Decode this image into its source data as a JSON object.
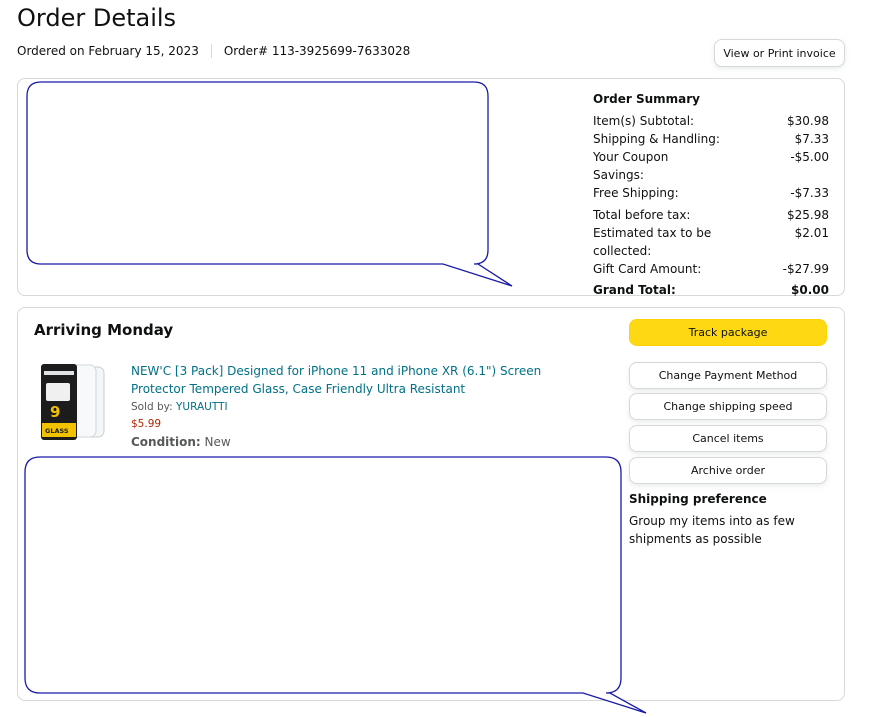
{
  "header": {
    "title": "Order Details",
    "ordered_on": "Ordered on February 15, 2023",
    "order_number": "Order# 113-3925699-7633028",
    "invoice_button": "View or Print invoice"
  },
  "summary": {
    "heading": "Order Summary",
    "subtotal": {
      "label": "Item(s) Subtotal:",
      "value": "$30.98"
    },
    "shipping": {
      "label": "Shipping & Handling:",
      "value": "$7.33"
    },
    "coupon": {
      "label": "Your Coupon Savings:",
      "value": "-$5.00"
    },
    "free_shipping": {
      "label": "Free Shipping:",
      "value": "-$7.33"
    },
    "before_tax": {
      "label": "Total before tax:",
      "value": "$25.98"
    },
    "tax": {
      "label": "Estimated tax to be collected:",
      "value": "$2.01"
    },
    "gift_card": {
      "label": "Gift Card Amount:",
      "value": "-$27.99"
    },
    "grand_total": {
      "label": "Grand Total:",
      "value": "$0.00"
    }
  },
  "shipment": {
    "status": "Arriving Monday",
    "item": {
      "title": "NEW'C [3 Pack] Designed for iPhone 11 and iPhone XR (6.1\") Screen Protector Tempered Glass, Case Friendly Ultra Resistant",
      "sold_by_label": "Sold by: ",
      "seller": "YURAUTTI",
      "price": "$5.99",
      "condition_label": "Condition:",
      "condition_value": " New",
      "thumbnail_icon": "screen-protector-product-image"
    },
    "actions": {
      "track": "Track package",
      "change_payment": "Change Payment Method",
      "change_speed": "Change shipping speed",
      "cancel": "Cancel items",
      "archive": "Archive order"
    },
    "preference": {
      "heading": "Shipping preference",
      "text": "Group my items into as few shipments as possible"
    }
  },
  "colors": {
    "link": "#007185",
    "price": "#b12704",
    "primary_button": "#ffd814",
    "annotation_stroke": "#1a1aa6"
  }
}
